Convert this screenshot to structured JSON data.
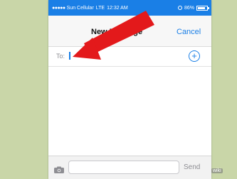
{
  "status_bar": {
    "carrier": "Sun Cellular",
    "network": "LTE",
    "time": "12:32 AM",
    "battery": "86%",
    "battery_level": 0.86,
    "signal_dots": "●●●●●"
  },
  "nav": {
    "title": "New Message",
    "cancel_label": "Cancel"
  },
  "compose": {
    "to_label": "To:",
    "add_icon": "plus-circle-icon",
    "message_placeholder": "",
    "send_label": "Send",
    "camera_icon": "camera-icon"
  },
  "watermark": "wiki",
  "colors": {
    "accent": "#1a7fe6",
    "arrow": "#e3191b",
    "background": "#c9d6a8"
  }
}
